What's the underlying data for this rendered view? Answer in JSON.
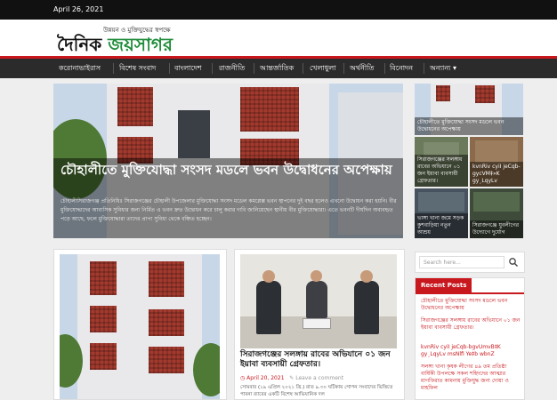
{
  "topbar": {
    "date": "April 26, 2021"
  },
  "logo": {
    "tagline": "উন্নয়ন ও মুক্তিযুদ্ধের স্বপক্ষে",
    "word1": "দৈনিক",
    "word2": "জয়সাগর"
  },
  "nav": {
    "items": [
      "করোনাভাইরাস",
      "বিশেষ সংবাদ",
      "বাংলাদেশ",
      "রাজনীতি",
      "আন্তর্জাতিক",
      "খেলাধুলা",
      "অর্থনীতি",
      "বিনোদন",
      "অন্যান্য ▾"
    ]
  },
  "hero": {
    "title": "চৌহালীতে মুক্তিযোদ্ধা সংসদ মডলে ভবন উদ্বোধনের অপেক্ষায়",
    "excerpt": "চৌহালীসিরাজগঞ্জ প্রতিনিধিঃ সিরাজগঞ্জের চৌহালী উপজেলার মুক্তিযোদ্ধা সংসদ মডেল কমপ্লেক্স ভবন স্থাপনের দুই বছর হলেও এখনো উদ্বোধন করা হয়নি। বীর মুক্তিযোদ্ধাদের আবাসিক সুবিধার জন্য নির্মিত এ ভবন দ্রুত উদ্বোধন করে চালু করার দাবি জানিয়েছেন স্থানীয় বীর মুক্তিযোদ্ধারা। এতে ভবনটি দীর্ঘদিন অব্যবহৃত পড়ে আছে, ফলে মুক্তিযোদ্ধারা তাদের প্রাপ্য সুবিধা থেকে বঞ্চিত হচ্ছেন।"
  },
  "side_thumbs": [
    {
      "caption": "চৌহালীতে মুক্তিযোদ্ধা সংসদ মডলে ভবন উদ্বোধনের অপেক্ষায়"
    },
    {
      "caption": "সিরাজগঞ্জের সলঙ্গায় রাবের অভিযানে ০১ জন ইয়াবা ব্যবসায়ী গ্রেফতার।"
    },
    {
      "caption": "kvnRiv cyiI jeCqb-​gycVM‡»K gy¸LqyLv"
    },
    {
      "caption": "ভাঙ্গা খানা জমে সড়ক কুশবাড়িয়া নতুন আশ্রয়"
    },
    {
      "caption": "সিরাজগঞ্জে যুবলীগের উদ্যোগে দুর্যোগ"
    }
  ],
  "card2": {
    "title": "সিরাজগঞ্জের সলঙ্গায় রাবের অভিযানে ০১ জন ইয়াবা ব্যবসায়ী গ্রেফতার।",
    "date": "April 20, 2021",
    "comment": "Leave a comment",
    "excerpt": "সোমবার (১৯ এপ্রিল ২০২১ খ্রি.) রাত ৯.৩০ ঘটিকায় গোপন সংবাদের ভিত্তিতে পাবনা র‍্যাবের একটি বিশেষ আভিযানিক দল"
  },
  "search": {
    "placeholder": "Search here..."
  },
  "recent_posts": {
    "title": "Recent Posts",
    "items": [
      "চৌহালীতে মুক্তিযোদ্ধা সংসদ মডলে ভবন উদ্বোধনের অপেক্ষায়",
      "সিরাজগঞ্জের সলঙ্গায় রাবের অভিযানে ০১ জন ইয়াবা ব্যবসায়ী গ্রেফতার।",
      "kvnRiv cyiI jeCqb-bgvUmvB‡K gy¸LqyLv msNlfi Ye‡b wbnZ",
      "সলঙ্গা খানা কৃষক লীগের ৪৯ তম প্রতিষ্ঠা বার্ষিকী উপলক্ষে সকল শহিদদের আত্মার মাগফিরাত কামনায় মুক্তিযুদ্ধ জন্য দোয়া ও মাহফিল"
    ]
  }
}
